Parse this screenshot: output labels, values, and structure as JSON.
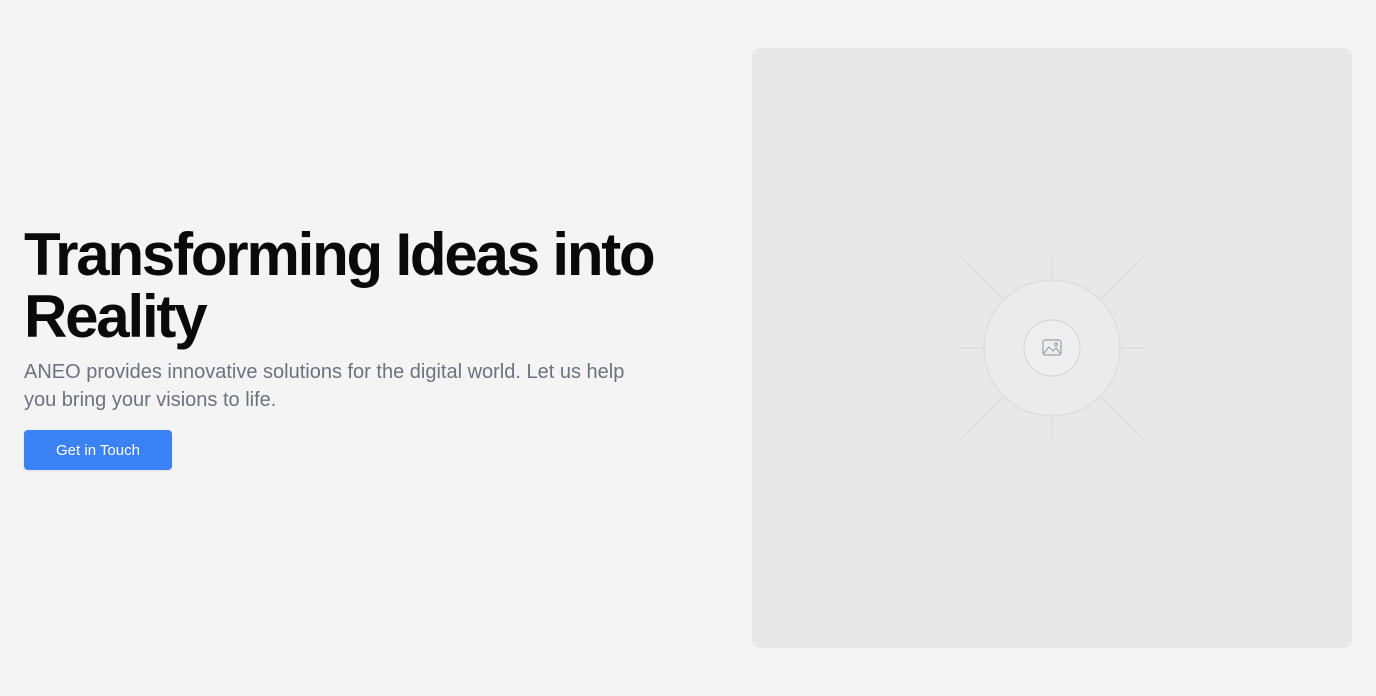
{
  "hero": {
    "title_line1": "Transforming Ideas into",
    "title_line2": "Reality",
    "subtitle": "ANEO provides innovative solutions for the digital world. Let us help you bring your visions to life.",
    "cta_label": "Get in Touch"
  },
  "media": {
    "icon": "image-icon"
  },
  "colors": {
    "page_background": "#f4f4f4",
    "placeholder_background": "#e8e8e8",
    "accent": "#3b82f6",
    "heading": "#0a0a0a",
    "body_text": "#6b7280"
  }
}
